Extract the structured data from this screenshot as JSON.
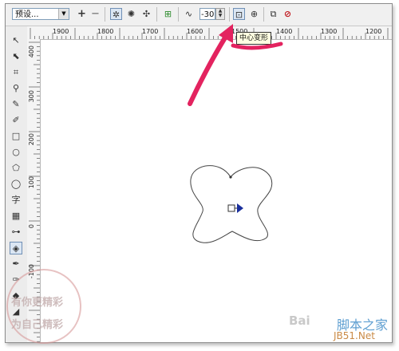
{
  "toolbar": {
    "preset_value": "预设...",
    "add_icon": "plus-icon",
    "remove_icon": "minus-icon",
    "angle_value": "-30",
    "center_distortion_tooltip": "中心变形"
  },
  "ruler": {
    "h_labels": [
      "1900",
      "1800",
      "1700",
      "1600",
      "1500",
      "1400",
      "1300",
      "1200"
    ],
    "v_labels": [
      "400",
      "300",
      "200",
      "100",
      "0",
      "-100"
    ]
  },
  "toolbox": {
    "text_tool_label": "字"
  },
  "watermark": {
    "line1": "有你更精彩",
    "line2": "为自己精彩",
    "site_name": "脚本之家",
    "site_url": "JB51.Net",
    "baidu": "Bai"
  },
  "colors": {
    "arrow": "#e3235f",
    "handle_blue": "#1a2f9c"
  }
}
